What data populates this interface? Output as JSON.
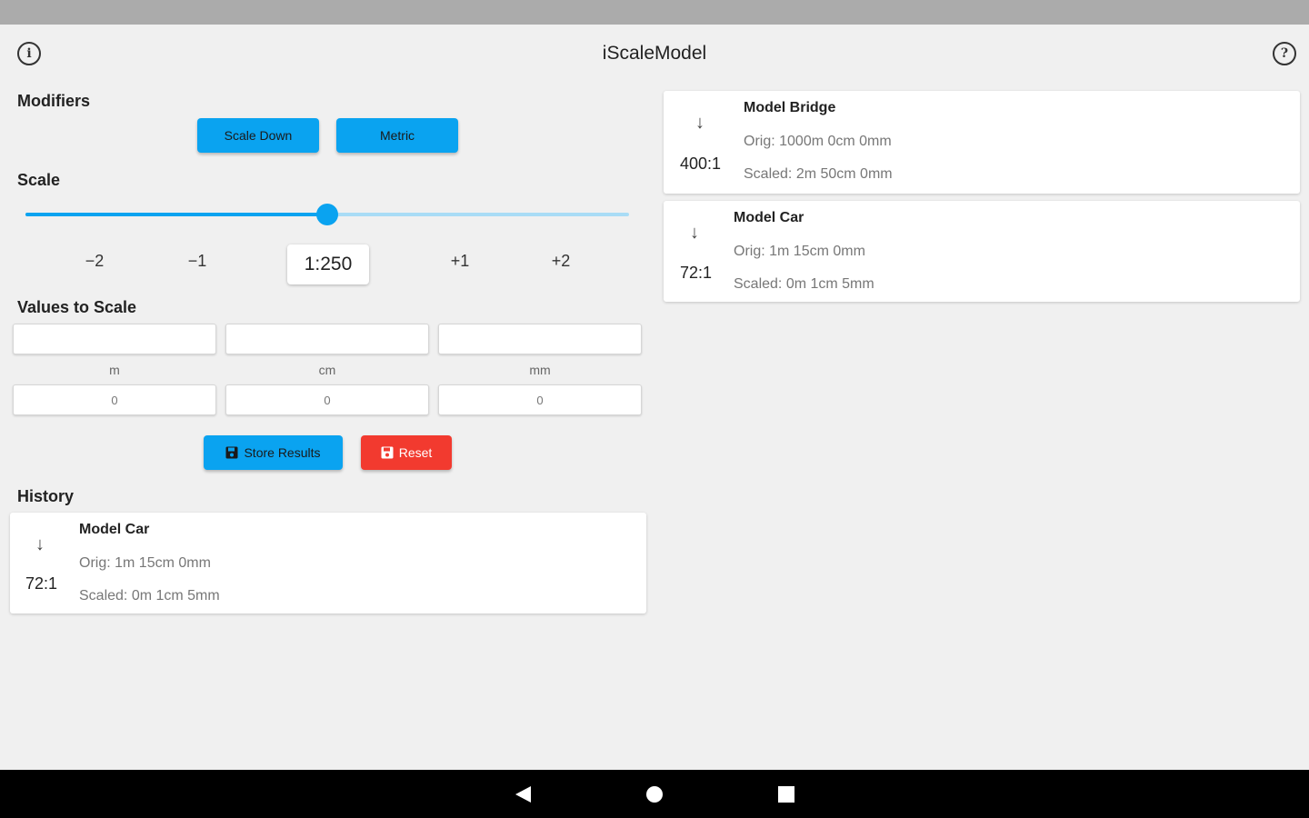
{
  "app": {
    "title": "iScaleModel",
    "info_icon": "info-icon",
    "help_icon": "help-icon",
    "info_glyph": "i",
    "help_glyph": "?"
  },
  "modifiers": {
    "label": "Modifiers",
    "scale_down_label": "Scale Down",
    "metric_label": "Metric"
  },
  "scale": {
    "label": "Scale",
    "slider_fraction": 0.5,
    "steps": [
      "−2",
      "−1",
      "+1",
      "+2"
    ],
    "current": "1:250"
  },
  "values": {
    "label": "Values to Scale",
    "inputs_top": [
      "",
      "",
      ""
    ],
    "units": [
      "m",
      "cm",
      "mm"
    ],
    "inputs_bottom": [
      "0",
      "0",
      "0"
    ]
  },
  "actions": {
    "store_label": "Store Results",
    "reset_label": "Reset",
    "save_icon": "floppy-disk-icon"
  },
  "history": {
    "label": "History",
    "left_items": [
      {
        "name": "Model Car",
        "ratio": "72:1",
        "orig": "Orig: 1m 15cm 0mm",
        "scaled": "Scaled: 0m 1cm 5mm",
        "arrow": "↓"
      }
    ],
    "right_items": [
      {
        "name": "Model Bridge",
        "ratio": "400:1",
        "orig": "Orig: 1000m 0cm 0mm",
        "scaled": "Scaled: 2m 50cm 0mm",
        "arrow": "↓"
      },
      {
        "name": "Model Car",
        "ratio": "72:1",
        "orig": "Orig: 1m 15cm 0mm",
        "scaled": "Scaled: 0m 1cm 5mm",
        "arrow": "↓"
      }
    ]
  },
  "colors": {
    "accent": "#0aa3f0",
    "danger": "#f23a2f",
    "background": "#f0f0f0"
  },
  "nav": {
    "back_icon": "back-triangle-icon",
    "home_icon": "home-circle-icon",
    "recents_icon": "recents-square-icon"
  }
}
